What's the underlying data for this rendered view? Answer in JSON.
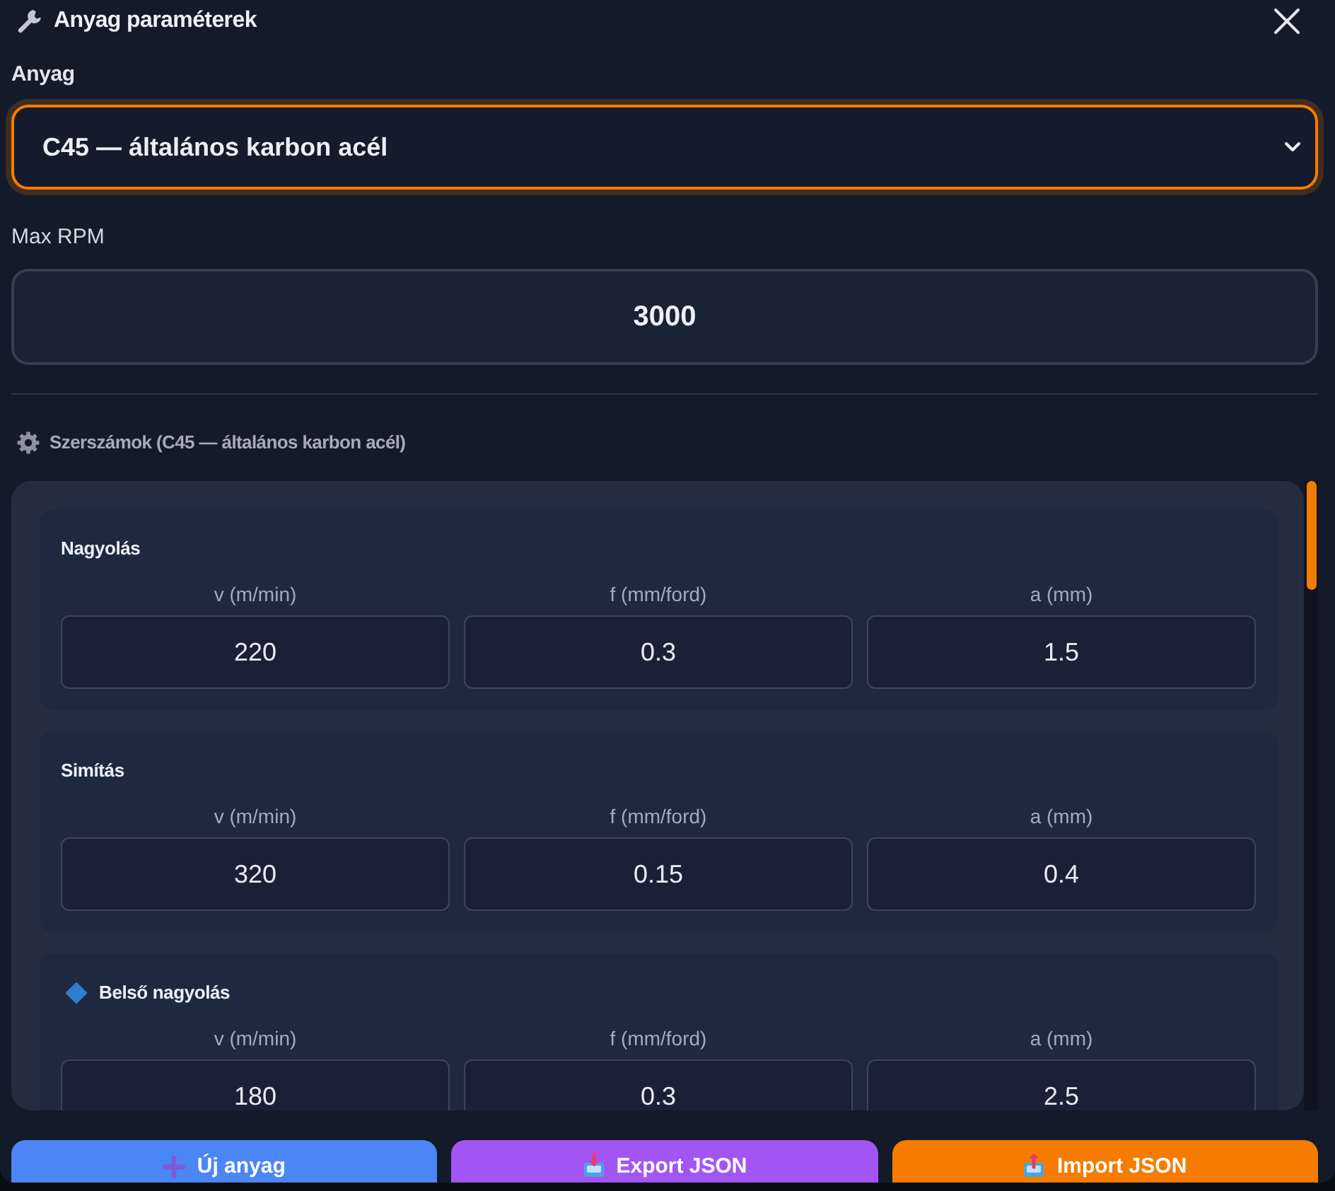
{
  "header": {
    "title": "Anyag paraméterek"
  },
  "material": {
    "label": "Anyag",
    "value": "C45 — általános karbon acél",
    "focused": true
  },
  "max_rpm": {
    "label": "Max RPM",
    "value": "3000"
  },
  "tools": {
    "title": "Szerszámok (C45 — általános karbon acél)",
    "cards": [
      {
        "title": "Nagyolás",
        "kind": "plain",
        "fields": [
          {
            "label": "v (m/min)",
            "value": "220"
          },
          {
            "label": "f (mm/ford)",
            "value": "0.3"
          },
          {
            "label": "a (mm)",
            "value": "1.5"
          }
        ]
      },
      {
        "title": "Simítás",
        "kind": "plain",
        "fields": [
          {
            "label": "v (m/min)",
            "value": "320"
          },
          {
            "label": "f (mm/ford)",
            "value": "0.15"
          },
          {
            "label": "a (mm)",
            "value": "0.4"
          }
        ]
      },
      {
        "title": "Belső nagyolás",
        "kind": "marked",
        "fields": [
          {
            "label": "v (m/min)",
            "value": "180"
          },
          {
            "label": "f (mm/ford)",
            "value": "0.3"
          },
          {
            "label": "a (mm)",
            "value": "2.5"
          }
        ]
      }
    ]
  },
  "footer": {
    "buttons": [
      {
        "label": "Új anyag",
        "kind": "add",
        "color": "#4b86f5"
      },
      {
        "label": "Export JSON",
        "kind": "export",
        "color": "#a355f4"
      },
      {
        "label": "Import JSON",
        "kind": "import",
        "color": "#f57c00"
      }
    ]
  }
}
